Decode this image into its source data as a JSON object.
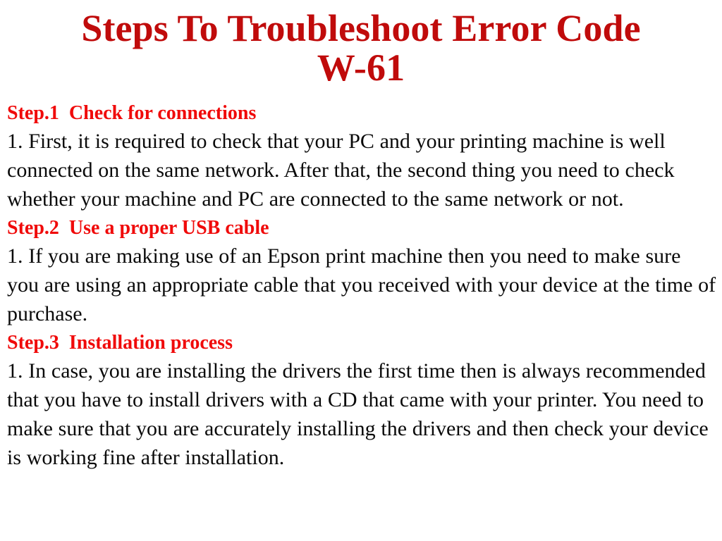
{
  "slide": {
    "background_color": "#ffffff",
    "title": {
      "color": "#c00b0b",
      "lines": [
        "Steps To Troubleshoot Error Code",
        "W-61"
      ]
    },
    "heading_color": "#f00a0a",
    "body_color": "#0a0a0a",
    "steps": [
      {
        "label": "Step.1",
        "heading": "Step.1  Check for connections",
        "title": "Check for connections",
        "body": "1. First, it is required to check that your PC and your printing machine is well connected on the same network. After that, the second thing you need to check whether your machine and PC are connected to the same network or not."
      },
      {
        "label": "Step.2",
        "heading": "Step.2  Use a proper USB cable",
        "title": "Use a proper USB cable",
        "body": "1. If you are making use of an Epson print machine then you need to make sure you are using an appropriate cable that you received with your device at the time of purchase."
      },
      {
        "label": "Step.3",
        "heading": "Step.3  Installation process",
        "title": "Installation process",
        "body": "1. In case, you are installing the drivers the first time then is always recommended that you have to install drivers with a CD that came with your printer. You need to make sure that you are accurately installing the drivers and then check your device is working fine after installation."
      }
    ]
  }
}
